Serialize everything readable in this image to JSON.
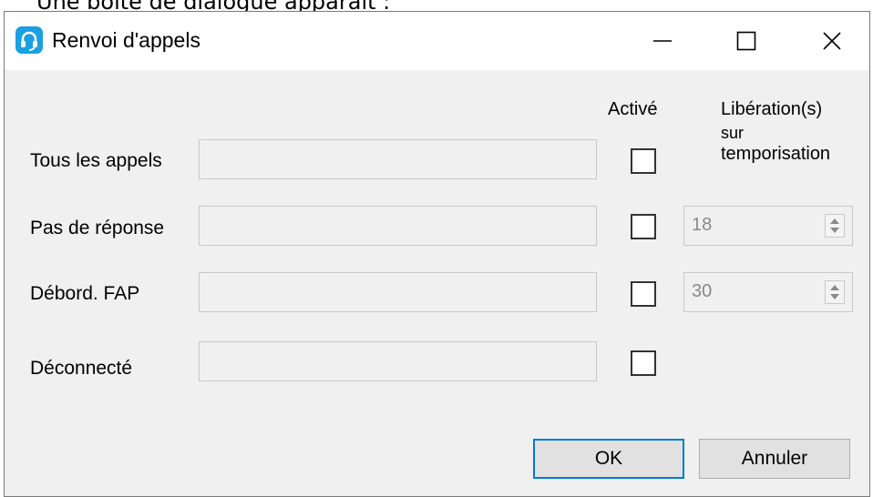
{
  "caption": "Une boîte de dialogue apparaît :",
  "window": {
    "title": "Renvoi d'appels",
    "icon": "headset-icon",
    "minimize_glyph": "—",
    "maximize_glyph": "☐",
    "close_glyph": "✕"
  },
  "headers": {
    "active": "Activé",
    "release_line1": "Libération(s)",
    "release_line2": "sur",
    "release_line3": "temporisation"
  },
  "rows": [
    {
      "label": "Tous les appels",
      "value": "",
      "checked": false
    },
    {
      "label": "Pas de réponse",
      "value": "",
      "checked": false,
      "timer": "18"
    },
    {
      "label": "Débord. FAP",
      "value": "",
      "checked": false,
      "timer": "30"
    },
    {
      "label": "Déconnecté",
      "value": "",
      "checked": false
    }
  ],
  "buttons": {
    "ok": "OK",
    "cancel": "Annuler"
  },
  "colors": {
    "accent": "#0078d7",
    "icon": "#1a9fe0"
  }
}
